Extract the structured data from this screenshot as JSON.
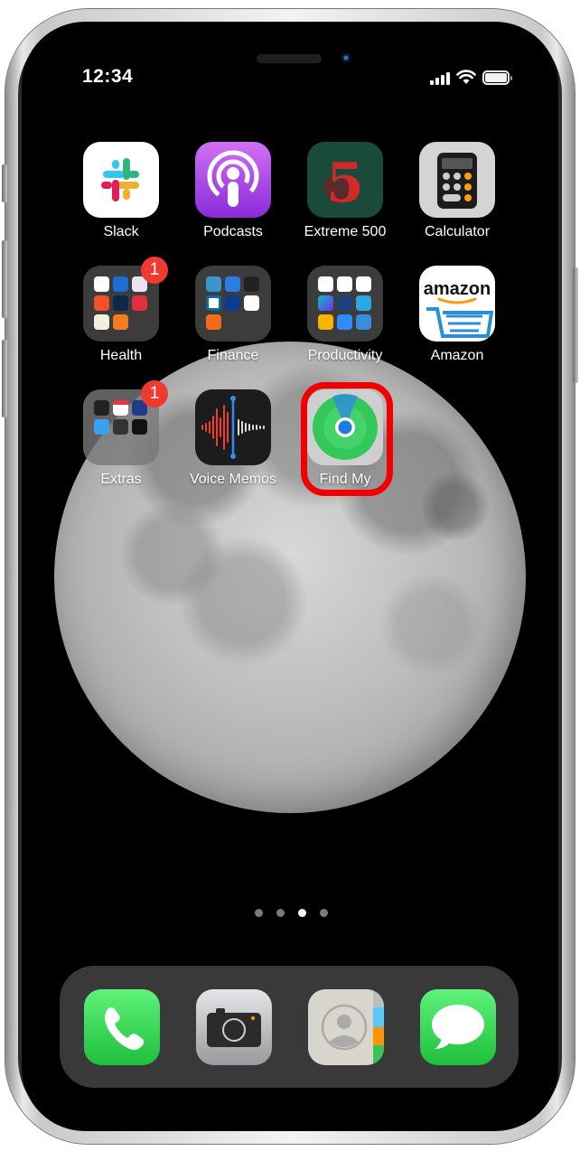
{
  "status_bar": {
    "time": "12:34",
    "signal_bars": 4,
    "wifi": "connected",
    "battery_level": 1.0
  },
  "home_screen": {
    "rows": [
      [
        {
          "label": "Slack",
          "type": "app",
          "icon": "slack-icon"
        },
        {
          "label": "Podcasts",
          "type": "app",
          "icon": "podcasts-icon"
        },
        {
          "label": "Extreme 500",
          "type": "app",
          "icon": "extreme-500-icon"
        },
        {
          "label": "Calculator",
          "type": "app",
          "icon": "calculator-icon"
        }
      ],
      [
        {
          "label": "Health",
          "type": "folder",
          "badge": "1"
        },
        {
          "label": "Finance",
          "type": "folder"
        },
        {
          "label": "Productivity",
          "type": "folder"
        },
        {
          "label": "Amazon",
          "type": "app",
          "icon": "amazon-icon",
          "wordmark": "amazon"
        }
      ],
      [
        {
          "label": "Extras",
          "type": "folder",
          "badge": "1"
        },
        {
          "label": "Voice Memos",
          "type": "app",
          "icon": "voice-memos-icon"
        },
        {
          "label": "Find My",
          "type": "app",
          "icon": "find-my-icon",
          "highlighted": true
        }
      ]
    ],
    "highlight_color": "#f20000"
  },
  "page_indicator": {
    "total": 4,
    "current": 3
  },
  "dock": [
    {
      "label": "Phone",
      "icon": "phone-icon"
    },
    {
      "label": "Camera",
      "icon": "camera-icon"
    },
    {
      "label": "Contacts",
      "icon": "contacts-icon"
    },
    {
      "label": "Messages",
      "icon": "messages-icon"
    }
  ],
  "colors": {
    "badge": "#f03a30",
    "dock_bg": "#3c3c3c",
    "green_app": "#34c759"
  }
}
